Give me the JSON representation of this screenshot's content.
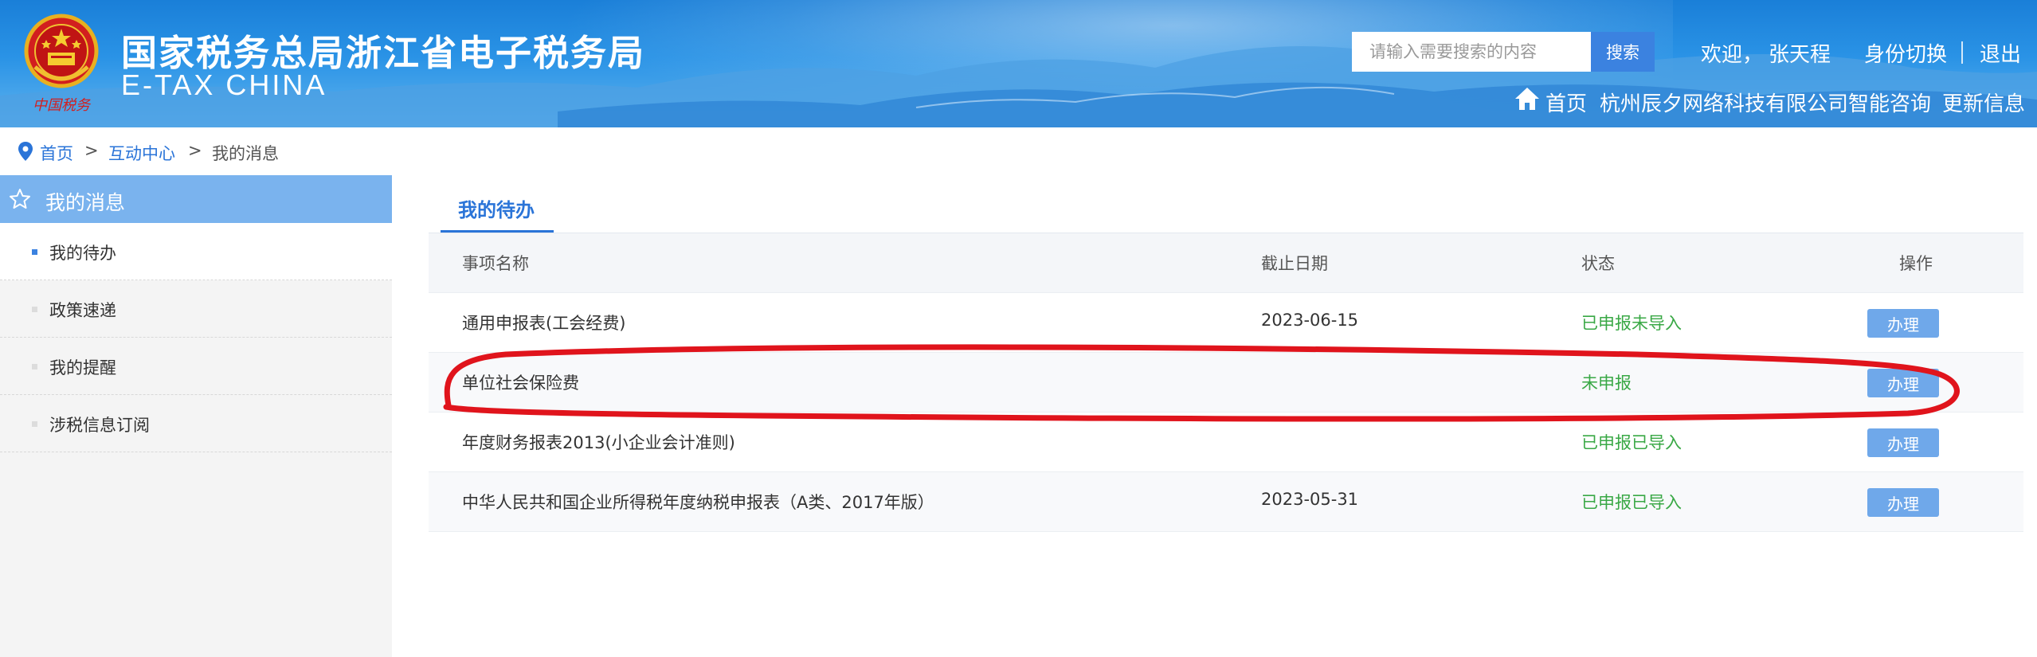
{
  "header": {
    "title": "国家税务总局浙江省电子税务局",
    "subtitle": "E-TAX CHINA",
    "emblem_caption": "中国税务",
    "search": {
      "placeholder": "请输入需要搜索的内容",
      "button": "搜索"
    },
    "welcome": "欢迎，",
    "username": "张天程",
    "switch_identity": "身份切换",
    "logout": "退出",
    "nav": {
      "home": "首页",
      "company": "杭州辰夕网络科技有限公司",
      "consult": "智能咨询",
      "update": "更新信息"
    }
  },
  "breadcrumb": {
    "home": "首页",
    "separator": ">",
    "interaction_center": "互动中心",
    "current": "我的消息"
  },
  "sidebar": {
    "title": "我的消息",
    "items": [
      {
        "label": "我的待办",
        "active": true
      },
      {
        "label": "政策速递",
        "active": false
      },
      {
        "label": "我的提醒",
        "active": false
      },
      {
        "label": "涉税信息订阅",
        "active": false
      }
    ]
  },
  "main": {
    "tab": "我的待办",
    "table": {
      "columns": [
        "事项名称",
        "截止日期",
        "状态",
        "操作"
      ],
      "rows": [
        {
          "name": "通用申报表(工会经费)",
          "deadline": "2023-06-15",
          "status": "已申报未导入",
          "action": "办理"
        },
        {
          "name": "单位社会保险费",
          "deadline": "",
          "status": "未申报",
          "action": "办理"
        },
        {
          "name": "年度财务报表2013(小企业会计准则)",
          "deadline": "",
          "status": "已申报已导入",
          "action": "办理"
        },
        {
          "name": "中华人民共和国企业所得税年度纳税申报表（A类、2017年版）",
          "deadline": "2023-05-31",
          "status": "已申报已导入",
          "action": "办理"
        }
      ]
    }
  },
  "icons": {
    "home": "home-icon",
    "location": "location-pin-icon",
    "star": "star-icon",
    "emblem": "national-emblem-icon"
  },
  "colors": {
    "header_blue": "#2a93e6",
    "link_blue": "#2a74d8",
    "sidebar_head": "#7ab3ee",
    "status_green": "#39a845",
    "button_blue": "#6fa8ea",
    "annotation_red": "#e0141c"
  }
}
